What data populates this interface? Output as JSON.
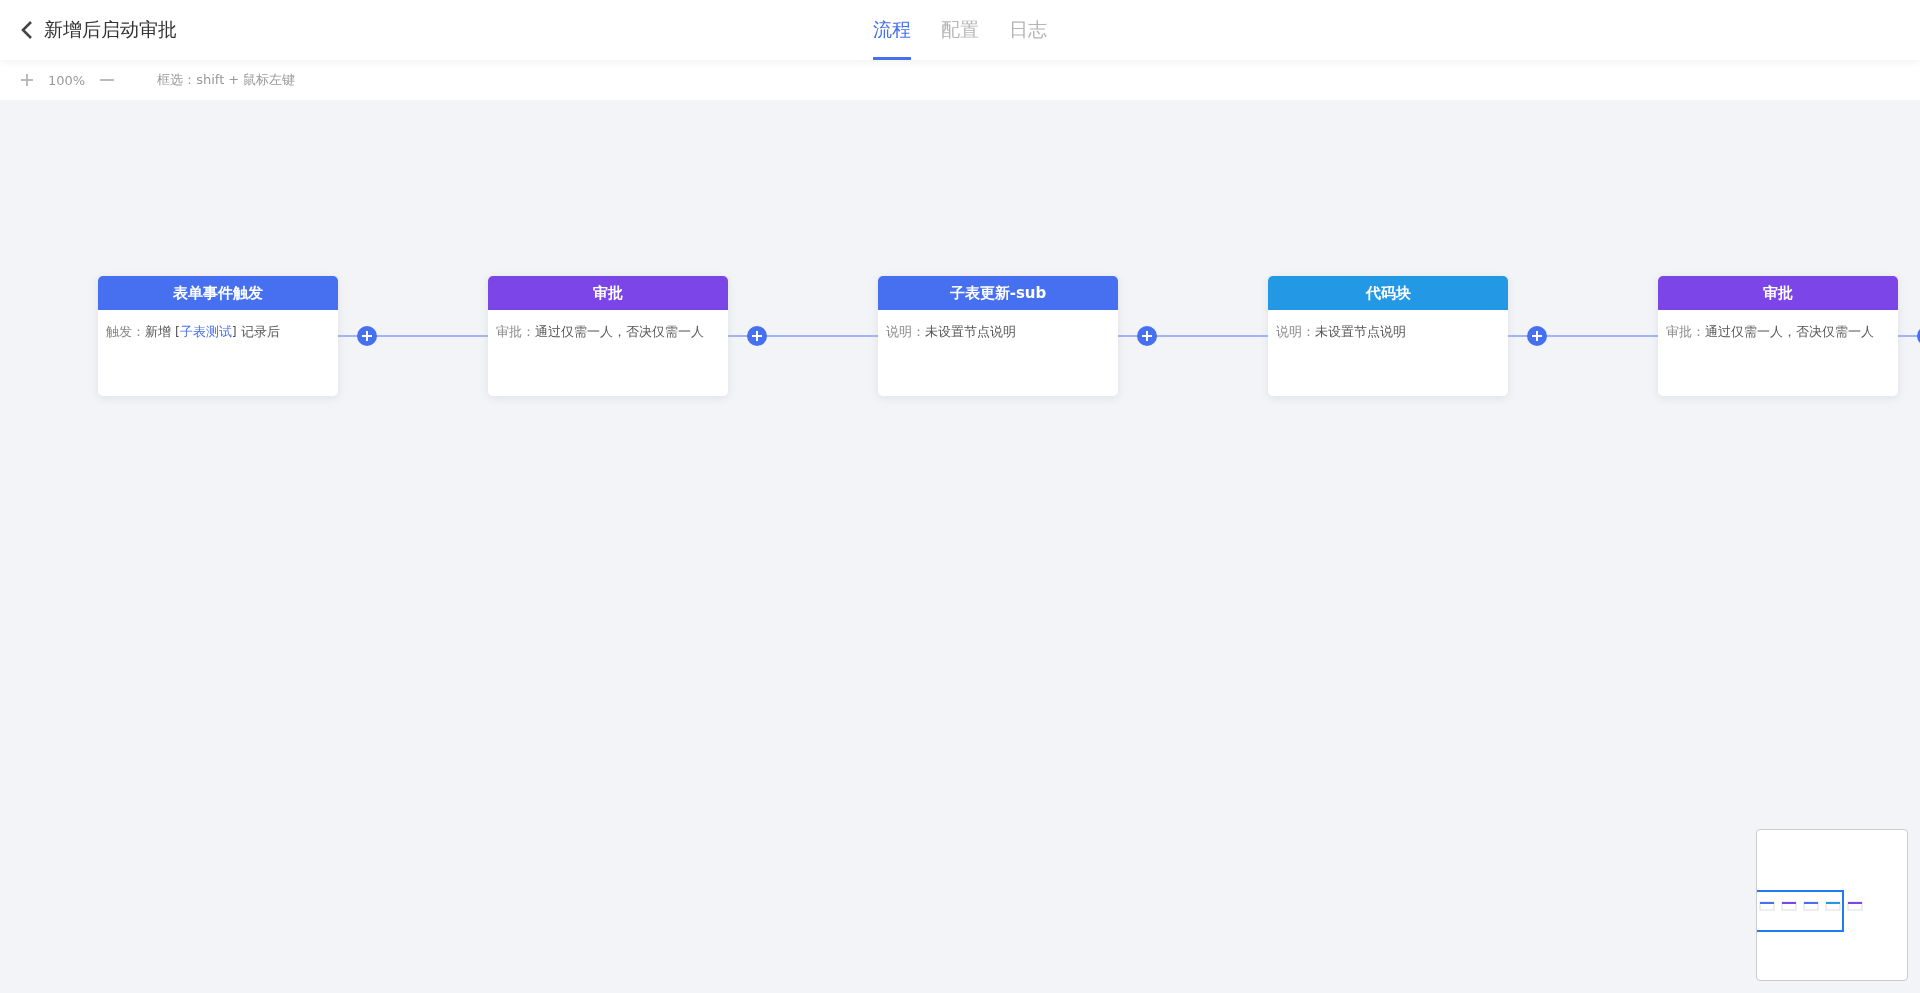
{
  "header": {
    "title": "新增后启动审批",
    "tabs": [
      {
        "label": "流程",
        "selected": true
      },
      {
        "label": "配置",
        "selected": false
      },
      {
        "label": "日志",
        "selected": false
      }
    ]
  },
  "toolbar": {
    "zoom": "100%",
    "hint": "框选：shift + 鼠标左键"
  },
  "nodes": [
    {
      "title": "表单事件触发",
      "color": "#4670ef",
      "label": "触发：",
      "segments": [
        {
          "text": "新增 [",
          "link": false
        },
        {
          "text": "子表测试",
          "link": true
        },
        {
          "text": "] 记录后",
          "link": false
        }
      ]
    },
    {
      "title": "审批",
      "color": "#7b45e8",
      "label": "审批：",
      "segments": [
        {
          "text": "通过仅需一人，否决仅需一人",
          "link": false
        }
      ]
    },
    {
      "title": "子表更新-sub",
      "color": "#4670ef",
      "label": "说明：",
      "segments": [
        {
          "text": "未设置节点说明",
          "link": false
        }
      ]
    },
    {
      "title": "代码块",
      "color": "#2399e5",
      "label": "说明：",
      "segments": [
        {
          "text": "未设置节点说明",
          "link": false
        }
      ]
    },
    {
      "title": "审批",
      "color": "#7b45e8",
      "label": "审批：",
      "segments": [
        {
          "text": "通过仅需一人，否决仅需一人",
          "link": false
        }
      ]
    }
  ]
}
